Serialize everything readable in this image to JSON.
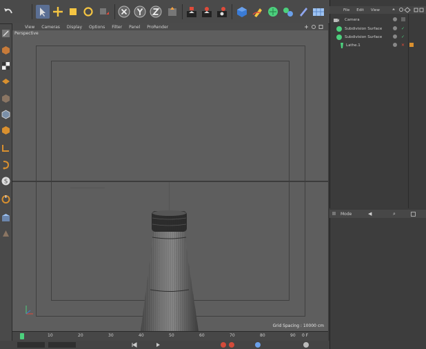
{
  "viewport": {
    "menu": [
      "View",
      "Cameras",
      "Display",
      "Options",
      "Filter",
      "Panel",
      "ProRender"
    ],
    "label": "Perspective",
    "grid_spacing": "Grid Spacing : 10000 cm"
  },
  "object_manager": {
    "menu": [
      "File",
      "Edit",
      "View"
    ],
    "objects": [
      {
        "name": "Camera",
        "icon": "camera-icon"
      },
      {
        "name": "Subdivision Surface",
        "icon": "subdivision-surface-icon"
      },
      {
        "name": "Subdivision Surface",
        "icon": "subdivision-surface-icon"
      },
      {
        "name": "Lathe.1",
        "icon": "lathe-icon"
      }
    ]
  },
  "attribute_manager": {
    "mode_label": "Mode"
  },
  "timeline": {
    "ticks": [
      "0",
      "10",
      "20",
      "30",
      "40",
      "50",
      "60",
      "70",
      "80",
      "90"
    ],
    "frame_end": "0 F"
  },
  "colors": {
    "viewport_bg": "#5e5e5e",
    "panel_bg": "#3b3b3b",
    "toolbar_bg": "#4a4a4a",
    "accent_green": "#4cd07d",
    "accent_blue": "#3a7bd5"
  }
}
